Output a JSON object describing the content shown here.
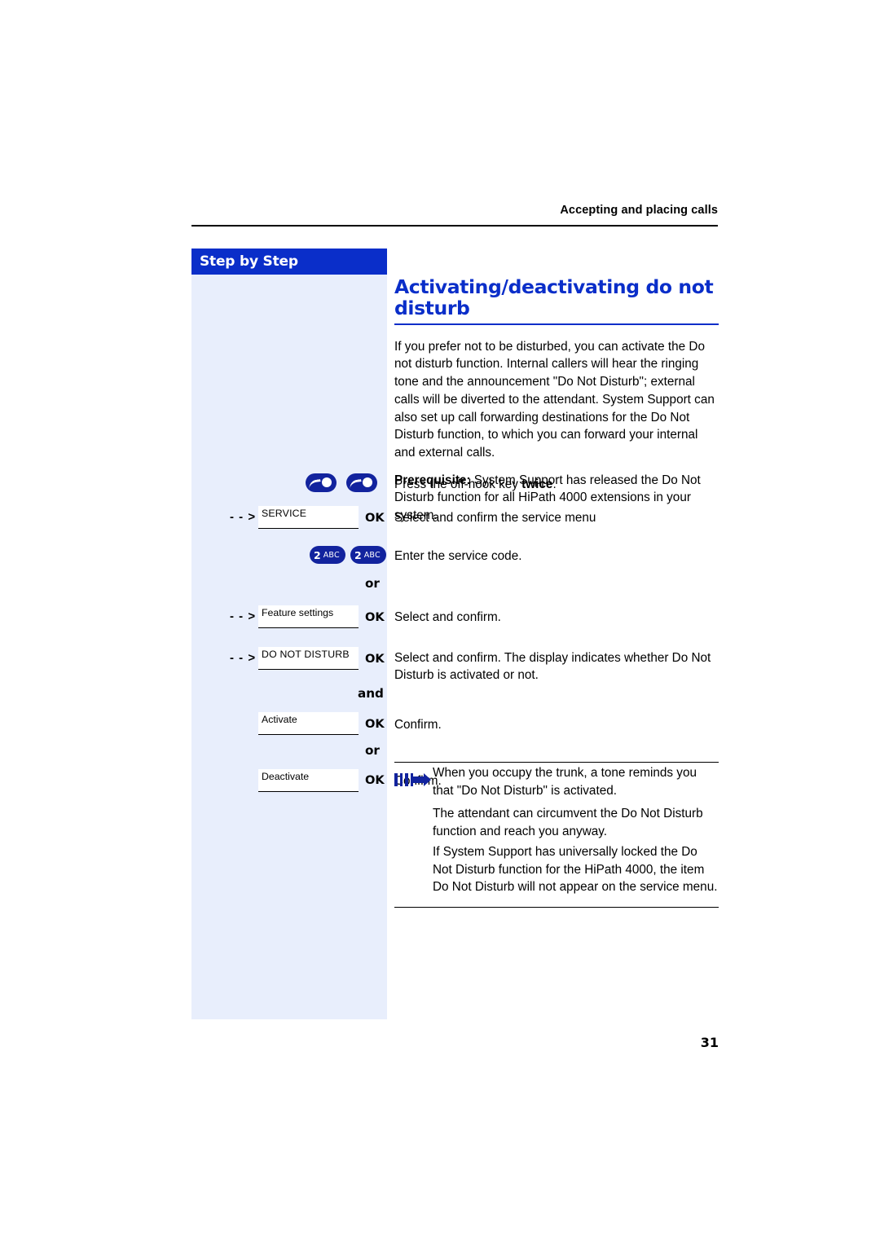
{
  "header": {
    "running_head": "Accepting and placing calls"
  },
  "sidebar": {
    "title": "Step by Step"
  },
  "main": {
    "title": "Activating/deactivating do not disturb",
    "paragraph1": "If you prefer not to be disturbed, you can activate the Do not disturb function. Internal callers will hear the ringing tone and the announcement \"Do Not Disturb\"; external calls will be diverted to the attendant. System Support can also set up call forwarding destinations for the Do Not Disturb function, to which you can forward your internal and external calls.",
    "prerequisite_label": "Prerequisite:",
    "prerequisite_text": " System Support has released the Do Not Disturb function for all HiPath 4000 extensions in your system."
  },
  "steps": [
    {
      "key_type": "hook-twice",
      "text_plain": "Press the off-hook key ",
      "text_bold": "twice",
      "text_tail": "."
    },
    {
      "key_type": "display",
      "display_label": "SERVICE",
      "ok_label": "OK",
      "text": "Select and confirm the service menu"
    },
    {
      "key_type": "dial-two",
      "dial_num": "2",
      "dial_abc": "ABC",
      "text": "Enter the service code."
    },
    {
      "key_type": "or",
      "or_label": "or"
    },
    {
      "key_type": "display",
      "display_label": "Feature settings",
      "ok_label": "OK",
      "text": "Select and confirm."
    },
    {
      "key_type": "display",
      "display_label": "DO NOT DISTURB",
      "ok_label": "OK",
      "text": "Select and confirm. The display indicates whether Do Not Disturb is activated or not."
    },
    {
      "key_type": "and",
      "and_label": "and"
    },
    {
      "key_type": "display-noarrow",
      "display_label": "Activate",
      "ok_label": "OK",
      "text": "Confirm."
    },
    {
      "key_type": "or",
      "or_label": "or"
    },
    {
      "key_type": "display-noarrow",
      "display_label": "Deactivate",
      "ok_label": "OK",
      "text": "Confirm."
    }
  ],
  "notes": [
    "When you occupy the trunk, a tone reminds you that \"Do Not Disturb\" is activated.",
    "The attendant can circumvent the Do Not Disturb function and reach you anyway.",
    "If System Support has universally locked the Do Not Disturb function for the HiPath 4000, the item Do Not Disturb will not appear on the service menu."
  ],
  "footer": {
    "page_number": "31"
  },
  "colors": {
    "accent_blue": "#0a2ec9",
    "panel_blue": "#e8eefc",
    "key_blue": "#12239e"
  }
}
